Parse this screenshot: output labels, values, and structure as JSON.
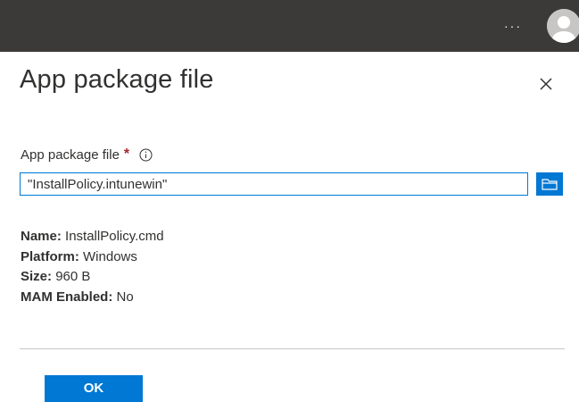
{
  "topbar": {
    "more_label": "···",
    "more_icon": "ellipsis-icon",
    "avatar_icon": "user-avatar-icon"
  },
  "panel": {
    "title": "App package file",
    "close_icon": "close-icon"
  },
  "field": {
    "label": "App package file",
    "required_marker": "*",
    "info_icon": "info-icon",
    "value": "\"InstallPolicy.intunewin\"",
    "browse_icon": "folder-icon"
  },
  "details": [
    {
      "key": "Name:",
      "value": "InstallPolicy.cmd"
    },
    {
      "key": "Platform:",
      "value": "Windows"
    },
    {
      "key": "Size:",
      "value": "960 B"
    },
    {
      "key": "MAM Enabled:",
      "value": "No"
    }
  ],
  "footer": {
    "ok_label": "OK"
  },
  "colors": {
    "accent": "#0078d4",
    "topbar": "#3b3a39",
    "required": "#a4262c",
    "divider": "#c8c6c4"
  }
}
